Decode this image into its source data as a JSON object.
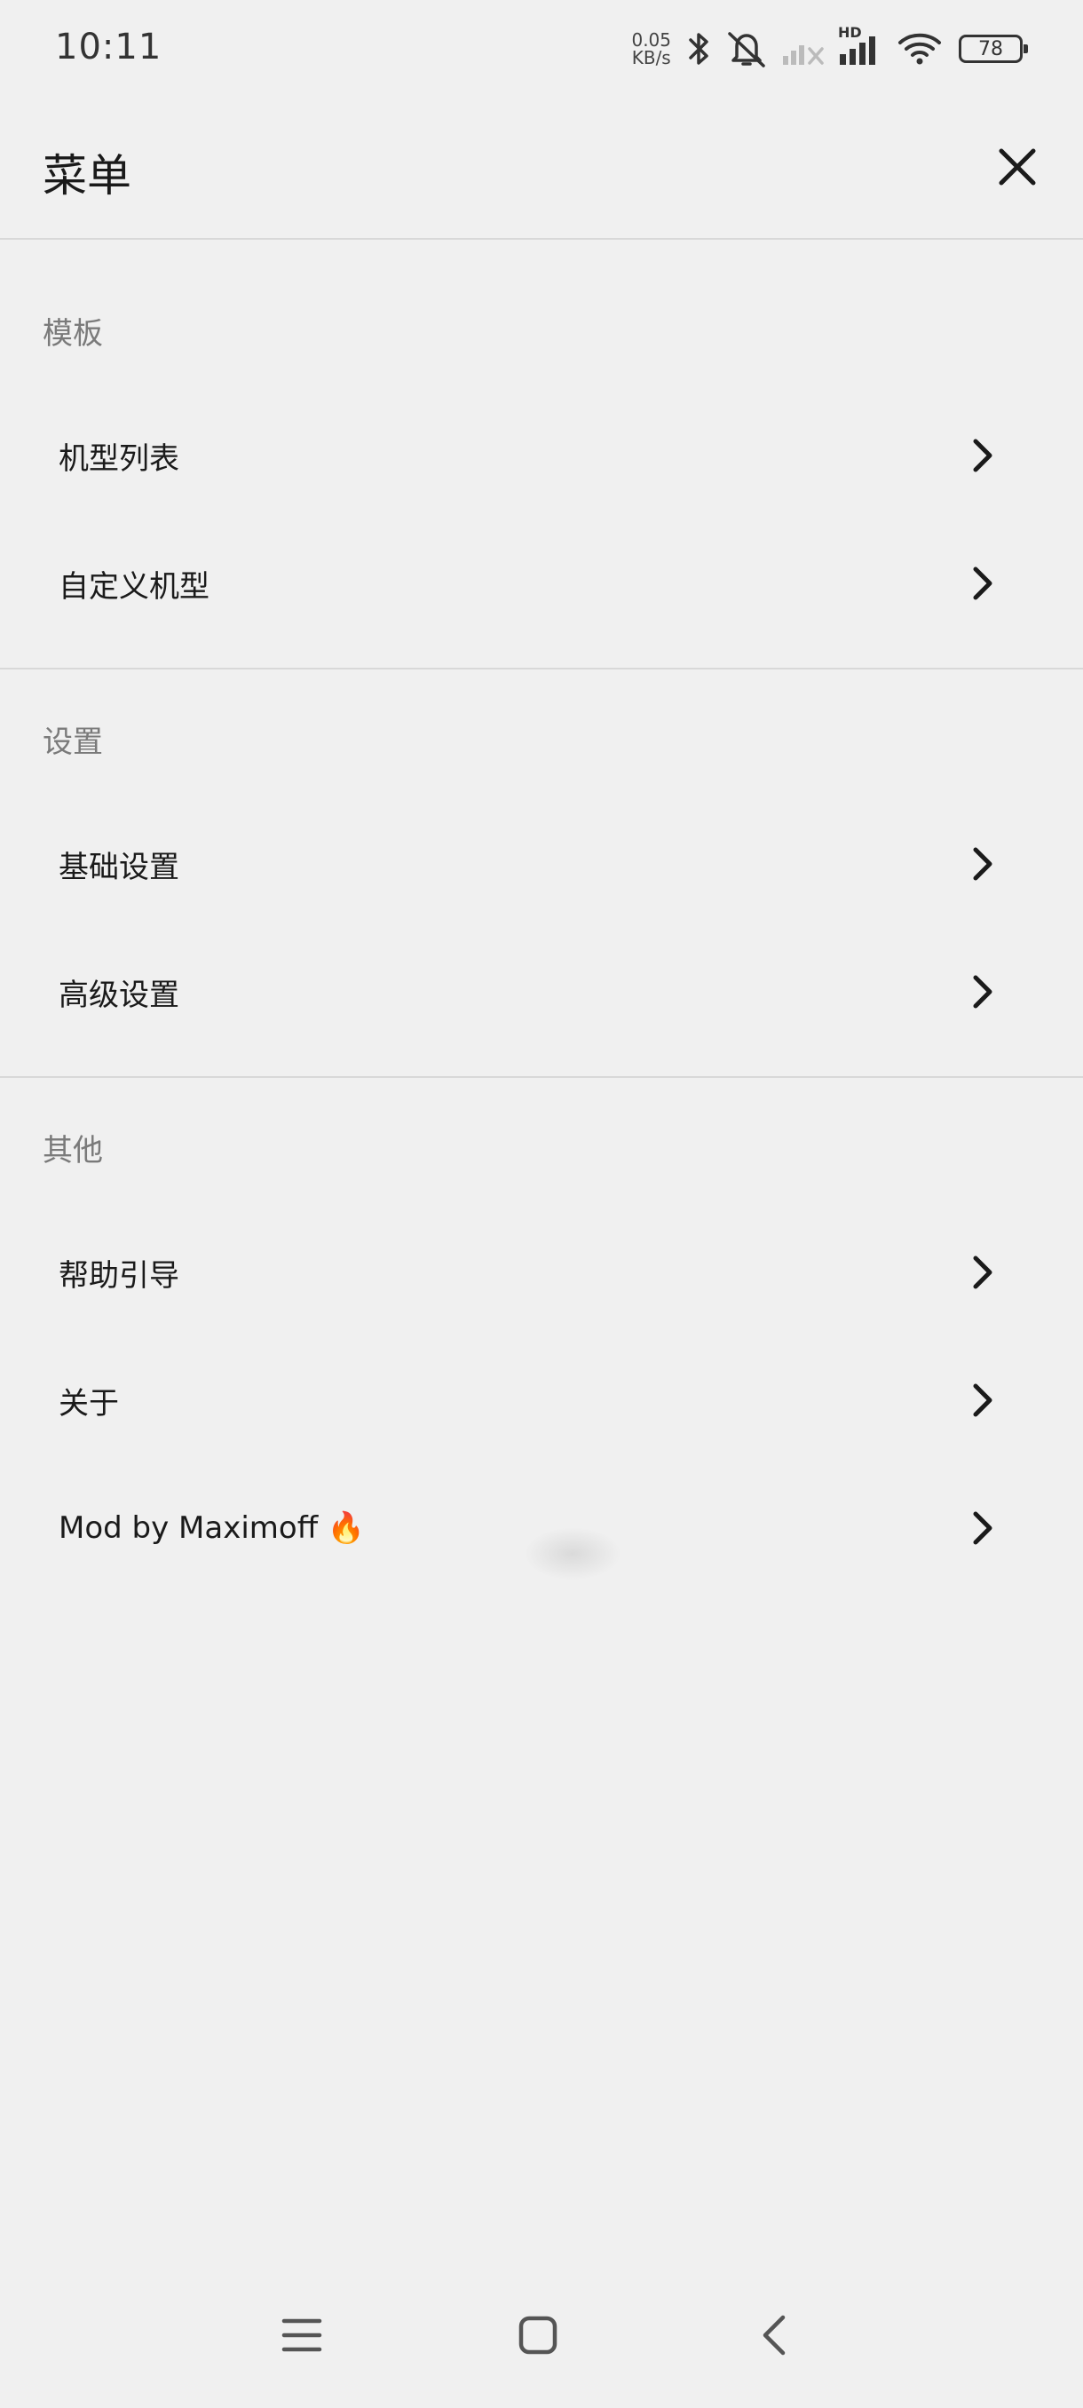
{
  "status_bar": {
    "time": "10:11",
    "net_speed_value": "0.05",
    "net_speed_unit": "KB/s",
    "network_badge": "HD",
    "battery": "78"
  },
  "header": {
    "title": "菜单"
  },
  "sections": [
    {
      "label": "模板",
      "items": [
        {
          "label": "机型列表"
        },
        {
          "label": "自定义机型"
        }
      ]
    },
    {
      "label": "设置",
      "items": [
        {
          "label": "基础设置"
        },
        {
          "label": "高级设置"
        }
      ]
    },
    {
      "label": "其他",
      "items": [
        {
          "label": "帮助引导"
        },
        {
          "label": "关于"
        },
        {
          "label": "Mod by Maximoff 🔥"
        }
      ]
    }
  ],
  "icons": {
    "close": "close-icon",
    "chevron": "chevron-right-icon",
    "nav_menu": "menu-icon",
    "nav_home": "home-icon",
    "nav_back": "back-icon"
  }
}
